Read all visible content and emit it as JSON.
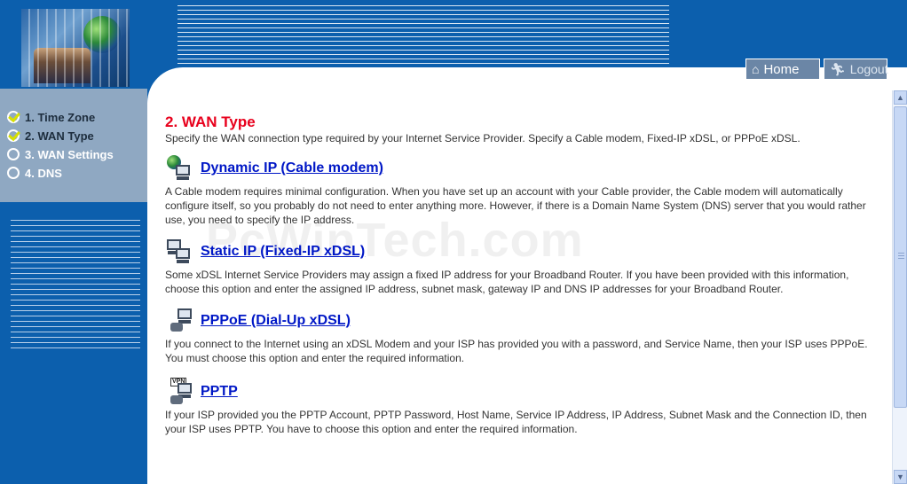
{
  "header": {
    "home_label": "Home",
    "logout_label": "Logout"
  },
  "sidebar": {
    "steps": [
      {
        "label": "1. Time Zone",
        "done": true
      },
      {
        "label": "2. WAN Type",
        "done": true
      },
      {
        "label": "3. WAN Settings",
        "done": false
      },
      {
        "label": "4. DNS",
        "done": false
      }
    ]
  },
  "main": {
    "title": "2. WAN Type",
    "subtitle": "Specify the WAN connection type required by your Internet Service Provider. Specify a Cable modem, Fixed-IP xDSL, or PPPoE xDSL.",
    "options": [
      {
        "link": "Dynamic IP (Cable modem)",
        "icon": "cable-modem-icon",
        "description": "A Cable modem requires minimal configuration. When you have set up an account with your Cable provider, the Cable modem will automatically configure itself, so you probably do not need to enter anything more. However, if there is a Domain Name System (DNS) server that you would rather use, you need to specify the IP address."
      },
      {
        "link": "Static IP (Fixed-IP xDSL)",
        "icon": "fixed-ip-icon",
        "description": "Some xDSL Internet Service Providers may assign a fixed IP address for your Broadband Router. If you have been provided with this information, choose this option and enter the assigned IP address, subnet mask, gateway IP and DNS IP addresses for your Broadband Router."
      },
      {
        "link": "PPPoE (Dial-Up xDSL)",
        "icon": "dialup-icon",
        "description": "If you connect to the Internet using an xDSL Modem and your ISP has provided you with a password, and Service Name, then your ISP uses PPPoE. You must choose this option and enter the required information."
      },
      {
        "link": "PPTP",
        "icon": "vpn-icon",
        "description": "If your ISP provided you the PPTP Account, PPTP Password, Host Name, Service IP Address, IP Address, Subnet Mask and the Connection ID, then your ISP uses PPTP. You have to choose this option and enter the required information."
      }
    ]
  },
  "watermark": "PcWinTech.com",
  "colors": {
    "brand_blue": "#0c5fad",
    "title_red": "#e8001c",
    "link_blue": "#0017c6"
  }
}
